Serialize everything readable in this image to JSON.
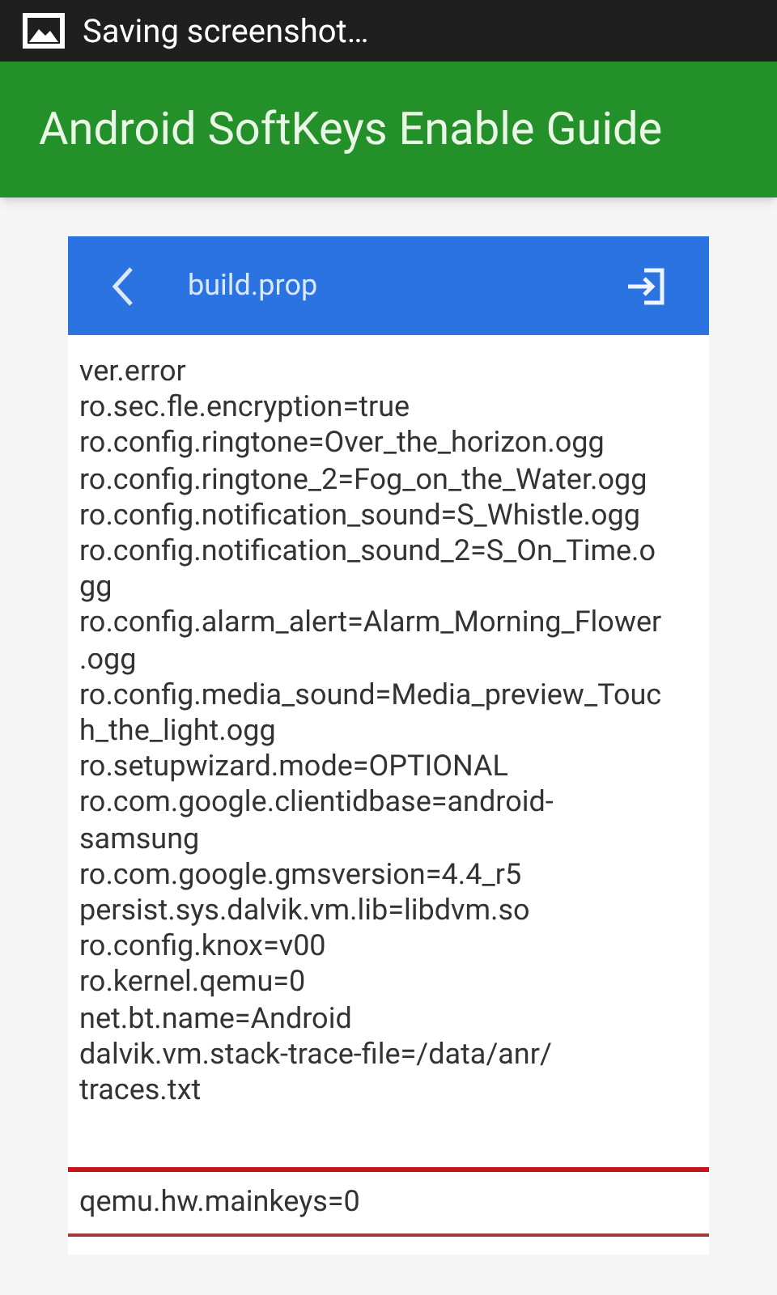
{
  "status_bar": {
    "notification": "Saving screenshot…"
  },
  "app_bar": {
    "title": "Android SoftKeys Enable Guide"
  },
  "screenshot": {
    "toolbar": {
      "title": "build.prop"
    },
    "lines": [
      "ver.error",
      "ro.sec.fle.encryption=true",
      "ro.config.ringtone=Over_the_horizon.ogg",
      "ro.config.ringtone_2=Fog_on_the_Water.ogg",
      "ro.config.notification_sound=S_Whistle.ogg",
      "ro.config.notification_sound_2=S_On_Time.o",
      "gg",
      "ro.config.alarm_alert=Alarm_Morning_Flower",
      ".ogg",
      "ro.config.media_sound=Media_preview_Touc",
      "h_the_light.ogg",
      "ro.setupwizard.mode=OPTIONAL",
      "ro.com.google.clientidbase=android-",
      "samsung",
      "ro.com.google.gmsversion=4.4_r5",
      "persist.sys.dalvik.vm.lib=libdvm.so",
      "ro.config.knox=v00",
      "ro.kernel.qemu=0",
      "net.bt.name=Android",
      "dalvik.vm.stack-trace-file=/data/anr/",
      "traces.txt"
    ],
    "highlight": "qemu.hw.mainkeys=0"
  }
}
